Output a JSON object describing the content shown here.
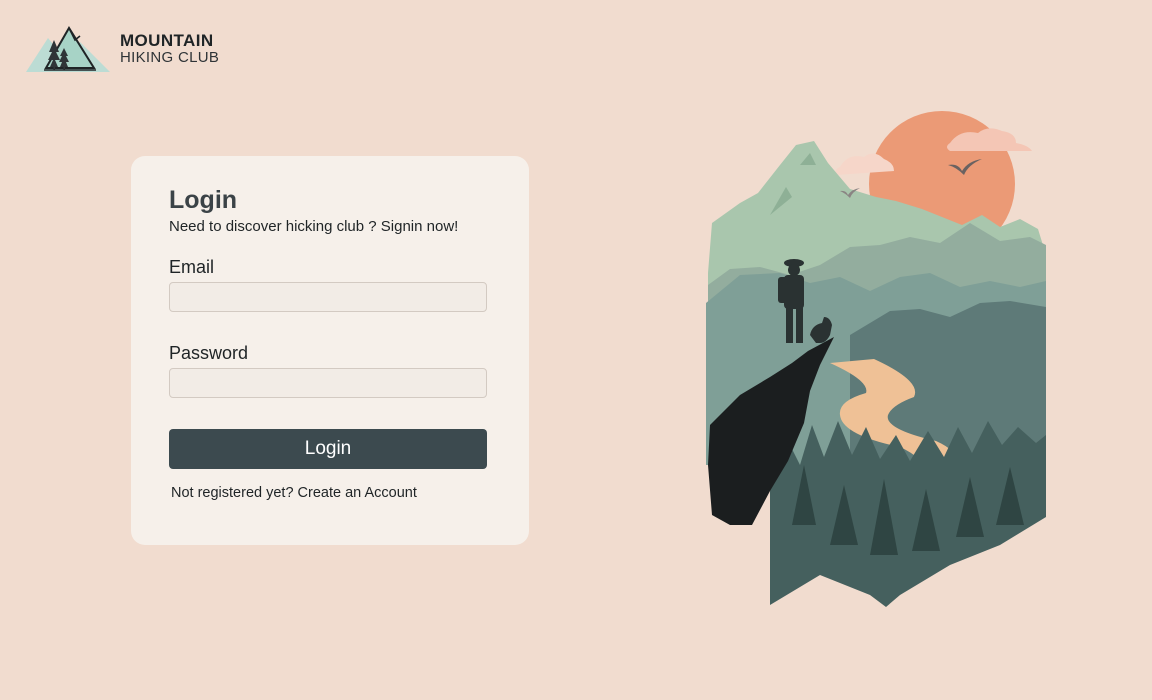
{
  "brand": {
    "name": "MOUNTAIN",
    "subtitle": "HIKING CLUB",
    "logo_icon": "mountain-pines-logo"
  },
  "login_card": {
    "title": "Login",
    "subtitle": "Need to discover hicking club ? Signin now!",
    "email_label": "Email",
    "email_value": "",
    "password_label": "Password",
    "password_value": "",
    "submit_label": "Login",
    "register_prompt": "Not registered yet?",
    "register_link": "Create an Account"
  },
  "illustration": {
    "icon": "hiker-mountain-illustration"
  },
  "colors": {
    "background": "#f1dccf",
    "card": "#f6f0ea",
    "button": "#3c4a4f",
    "sun": "#eb9a76",
    "mountain_light": "#a9c6ad",
    "mountain_mid": "#7f9f97",
    "mountain_dark": "#5e7a78",
    "river": "#efc196",
    "cliff": "#1b1e1f"
  }
}
